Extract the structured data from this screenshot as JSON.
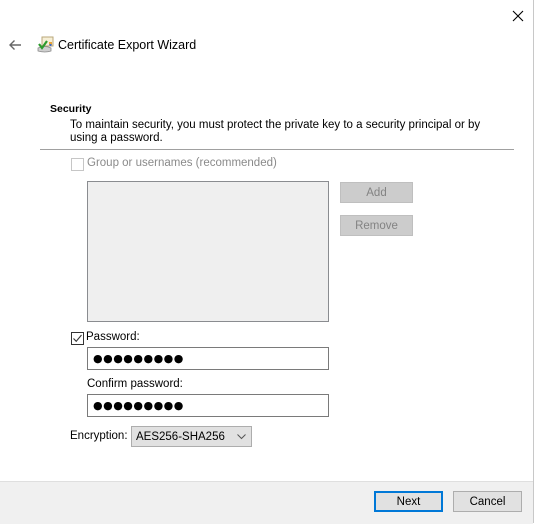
{
  "window": {
    "title": "Certificate Export Wizard",
    "icons": {
      "back": "back-arrow-icon",
      "close": "close-icon",
      "app": "certificate-wizard-icon"
    }
  },
  "section": {
    "title": "Security",
    "description": "To maintain security, you must protect the private key to a security principal or by using a password."
  },
  "group_option": {
    "label": "Group or usernames (recommended)",
    "checked": false,
    "enabled": false,
    "list_items": [],
    "add_label": "Add",
    "remove_label": "Remove"
  },
  "password_option": {
    "label": "Password:",
    "checked": true,
    "password_value": "●●●●●●●●●",
    "confirm_label": "Confirm password:",
    "confirm_value": "●●●●●●●●●"
  },
  "encryption": {
    "label": "Encryption:",
    "selected": "AES256-SHA256"
  },
  "footer": {
    "next_label": "Next",
    "cancel_label": "Cancel"
  },
  "colors": {
    "accent": "#0078d7",
    "footer_bg": "#f0f0f0",
    "disabled_text": "#838383"
  }
}
